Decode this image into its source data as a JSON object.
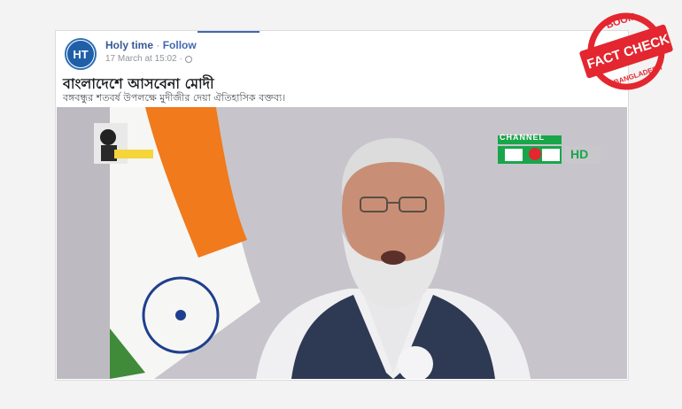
{
  "post": {
    "avatar_text": "HT",
    "page_name": "Holy time",
    "separator": "·",
    "follow_label": "Follow",
    "timestamp": "17 March at 15:02",
    "meta_separator": "·",
    "privacy_icon": "globe-icon",
    "title": "বাংলাদেশে আসবেনা মোদী",
    "subtitle": "বঙ্গবন্ধুর শতবর্ষ উপলক্ষে মুদীজীর দেয়া ঐতিহাসিক বক্তব্য।"
  },
  "video": {
    "channel_logo_text": "CHANNEL",
    "channel_logo_hd": "HD",
    "description_icons": [
      "indian-flag",
      "presenter",
      "channel-logo"
    ]
  },
  "badge": {
    "top_text": "BOOM",
    "main_text": "FACT CHECK",
    "bottom_text": "BANGLADESH",
    "color": "#e3262f"
  },
  "colors": {
    "accent": "#4267b2",
    "name": "#385898",
    "badge_red": "#e3262f"
  }
}
